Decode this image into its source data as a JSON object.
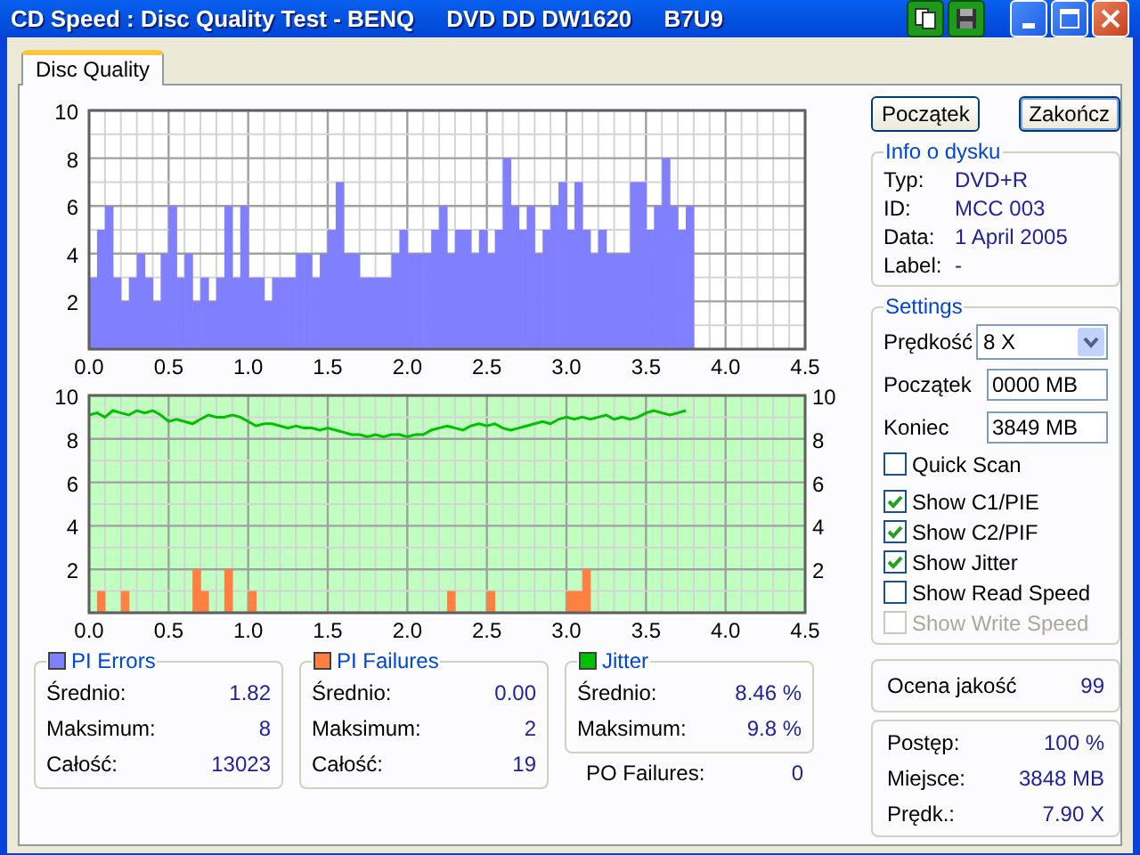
{
  "window": {
    "title": "CD Speed : Disc Quality Test - BENQ     DVD DD DW1620     B7U9"
  },
  "tabs": [
    {
      "label": "Disc Quality",
      "selected": true
    }
  ],
  "charts": [
    {
      "chart_data": {
        "type": "bar",
        "x": [
          0,
          0.05,
          0.1,
          0.15,
          0.2,
          0.25,
          0.3,
          0.35,
          0.4,
          0.45,
          0.5,
          0.55,
          0.6,
          0.65,
          0.7,
          0.75,
          0.8,
          0.85,
          0.9,
          0.95,
          1,
          1.05,
          1.1,
          1.15,
          1.2,
          1.25,
          1.3,
          1.35,
          1.4,
          1.45,
          1.5,
          1.55,
          1.6,
          1.65,
          1.7,
          1.75,
          1.8,
          1.85,
          1.9,
          1.95,
          2,
          2.05,
          2.1,
          2.15,
          2.2,
          2.25,
          2.3,
          2.35,
          2.4,
          2.45,
          2.5,
          2.55,
          2.6,
          2.65,
          2.7,
          2.75,
          2.8,
          2.85,
          2.9,
          2.95,
          3,
          3.05,
          3.1,
          3.15,
          3.2,
          3.25,
          3.3,
          3.35,
          3.4,
          3.45,
          3.5,
          3.55,
          3.6,
          3.65,
          3.7,
          3.75
        ],
        "grid": true,
        "series": [
          {
            "color": "#8080ff",
            "values": [
              3,
              5,
              6,
              3,
              2,
              3,
              4,
              3,
              2,
              4,
              6,
              3,
              4,
              2,
              3,
              2,
              3,
              6,
              3,
              6,
              3,
              3,
              2,
              3,
              3,
              3,
              4,
              4,
              3,
              4,
              5,
              7,
              4,
              4,
              3,
              3,
              3,
              3,
              4,
              5,
              4,
              4,
              4,
              5,
              6,
              4,
              5,
              5,
              4,
              5,
              4,
              5,
              8,
              6,
              5,
              6,
              4,
              5,
              6,
              7,
              5,
              7,
              5,
              4,
              5,
              4,
              4,
              4,
              7,
              7,
              5,
              6,
              8,
              6,
              5,
              6
            ]
          }
        ],
        "xlim": [
          0,
          4.5
        ],
        "ylim": [
          0,
          10
        ],
        "xticks": [
          {
            "value": 0,
            "label": "0.0"
          },
          {
            "value": 0.5,
            "label": "0.5"
          },
          {
            "value": 1,
            "label": "1.0"
          },
          {
            "value": 1.5,
            "label": "1.5"
          },
          {
            "value": 2,
            "label": "2.0"
          },
          {
            "value": 2.5,
            "label": "2.5"
          },
          {
            "value": 3,
            "label": "3.0"
          },
          {
            "value": 3.5,
            "label": "3.5"
          },
          {
            "value": 4,
            "label": "4.0"
          },
          {
            "value": 4.5,
            "label": "4.5"
          }
        ],
        "yticks": [
          2,
          4,
          6,
          8,
          10
        ]
      }
    },
    {
      "chart_data": {
        "type": "bar",
        "grid": true,
        "x": [
          0,
          0.05,
          0.1,
          0.15,
          0.2,
          0.25,
          0.3,
          0.35,
          0.4,
          0.45,
          0.5,
          0.55,
          0.6,
          0.65,
          0.7,
          0.75,
          0.8,
          0.85,
          0.9,
          0.95,
          1,
          1.05,
          1.1,
          1.15,
          1.2,
          1.25,
          1.3,
          1.35,
          1.4,
          1.45,
          1.5,
          1.55,
          1.6,
          1.65,
          1.7,
          1.75,
          1.8,
          1.85,
          1.9,
          1.95,
          2,
          2.05,
          2.1,
          2.15,
          2.2,
          2.25,
          2.3,
          2.35,
          2.4,
          2.45,
          2.5,
          2.55,
          2.6,
          2.65,
          2.7,
          2.75,
          2.8,
          2.85,
          2.9,
          2.95,
          3,
          3.05,
          3.1,
          3.15,
          3.2,
          3.25,
          3.3,
          3.35,
          3.4,
          3.45,
          3.5,
          3.55,
          3.6,
          3.65,
          3.7,
          3.75
        ],
        "series": [
          {
            "type": "line",
            "color": "#00c000",
            "values": [
              9.1,
              9.2,
              9.0,
              9.3,
              9.2,
              9.1,
              9.3,
              9.2,
              9.3,
              9.1,
              8.8,
              8.9,
              8.8,
              8.7,
              8.9,
              9.1,
              9.0,
              9.0,
              9.1,
              9.0,
              8.8,
              8.6,
              8.7,
              8.7,
              8.6,
              8.5,
              8.6,
              8.5,
              8.5,
              8.4,
              8.5,
              8.4,
              8.3,
              8.2,
              8.2,
              8.1,
              8.2,
              8.1,
              8.2,
              8.2,
              8.1,
              8.2,
              8.2,
              8.4,
              8.5,
              8.6,
              8.5,
              8.4,
              8.6,
              8.7,
              8.6,
              8.7,
              8.5,
              8.4,
              8.5,
              8.6,
              8.7,
              8.8,
              8.7,
              8.9,
              9.0,
              8.9,
              9.0,
              8.9,
              9.0,
              9.1,
              8.9,
              9.0,
              8.9,
              9.0,
              9.2,
              9.3,
              9.2,
              9.1,
              9.2,
              9.3
            ]
          },
          {
            "color": "#ff8040",
            "values": [
              0,
              1,
              0,
              0,
              1,
              0,
              0,
              0,
              0,
              0,
              0,
              0,
              0,
              2,
              1,
              0,
              0,
              2,
              0,
              0,
              1,
              0,
              0,
              0,
              0,
              0,
              0,
              0,
              0,
              0,
              0,
              0,
              0,
              0,
              0,
              0,
              0,
              0,
              0,
              0,
              0,
              0,
              0,
              0,
              0,
              1,
              0,
              0,
              0,
              0,
              1,
              0,
              0,
              0,
              0,
              0,
              0,
              0,
              0,
              0,
              1,
              1,
              2,
              0,
              0,
              0,
              0,
              0,
              0,
              0,
              0,
              0,
              0,
              0,
              0,
              0
            ]
          }
        ],
        "xlim": [
          0,
          4.5
        ],
        "ylim": [
          0,
          10
        ],
        "xticks": [
          {
            "value": 0,
            "label": "0.0"
          },
          {
            "value": 0.5,
            "label": "0.5"
          },
          {
            "value": 1,
            "label": "1.0"
          },
          {
            "value": 1.5,
            "label": "1.5"
          },
          {
            "value": 2,
            "label": "2.0"
          },
          {
            "value": 2.5,
            "label": "2.5"
          },
          {
            "value": 3,
            "label": "3.0"
          },
          {
            "value": 3.5,
            "label": "3.5"
          },
          {
            "value": 4,
            "label": "4.0"
          },
          {
            "value": 4.5,
            "label": "4.5"
          }
        ],
        "yticks": [
          2,
          4,
          6,
          8,
          10
        ],
        "annotations": [
          "2",
          "4",
          "6",
          "8",
          "10"
        ]
      }
    }
  ],
  "stats": [
    {
      "title": "PI Errors",
      "color": "#8080ff",
      "rows": [
        {
          "label": "Średnio:",
          "value": "1.82"
        },
        {
          "label": "Maksimum:",
          "value": "8"
        },
        {
          "label": "Całość:",
          "value": "13023"
        }
      ]
    },
    {
      "title": "PI Failures",
      "color": "#ff8040",
      "rows": [
        {
          "label": "Średnio:",
          "value": "0.00"
        },
        {
          "label": "Maksimum:",
          "value": "2"
        },
        {
          "label": "Całość:",
          "value": "19"
        }
      ]
    },
    {
      "title": "Jitter",
      "color": "#00c000",
      "rows": [
        {
          "label": "Średnio:",
          "value": "8.46 %"
        },
        {
          "label": "Maksimum:",
          "value": "9.8 %"
        }
      ]
    }
  ],
  "po_failures": {
    "label": "PO Failures:",
    "value": "0"
  },
  "buttons": [
    "Początek",
    "Zakończ"
  ],
  "disc_info": {
    "title": "Info o dysku",
    "rows": [
      {
        "label": "Typ:",
        "value": "DVD+R"
      },
      {
        "label": "ID:",
        "value": "MCC 003"
      },
      {
        "label": "Data:",
        "value": "1 April 2005"
      },
      {
        "label": "Label:",
        "value": "-"
      }
    ]
  },
  "settings": {
    "title": "Settings",
    "speed": {
      "label": "Prędkość",
      "value": "8 X"
    },
    "fields": [
      {
        "label": "Początek",
        "value": "0000 MB"
      },
      {
        "label": "Koniec",
        "value": "3849 MB"
      }
    ],
    "options": [
      {
        "label": "Quick Scan",
        "checked": false,
        "disabled": false
      },
      {
        "label": "Show C1/PIE",
        "checked": true,
        "disabled": false
      },
      {
        "label": "Show C2/PIF",
        "checked": true,
        "disabled": false
      },
      {
        "label": "Show Jitter",
        "checked": true,
        "disabled": false
      },
      {
        "label": "Show Read Speed",
        "checked": false,
        "disabled": false
      },
      {
        "label": "Show Write Speed",
        "checked": false,
        "disabled": true
      }
    ]
  },
  "quality": {
    "label": "Ocena jakość",
    "value": "99"
  },
  "progress": [
    {
      "label": "Postęp:",
      "value": "100 %"
    },
    {
      "label": "Miejsce:",
      "value": "3848 MB"
    },
    {
      "label": "Prędk.:",
      "value": "7.90 X"
    }
  ]
}
